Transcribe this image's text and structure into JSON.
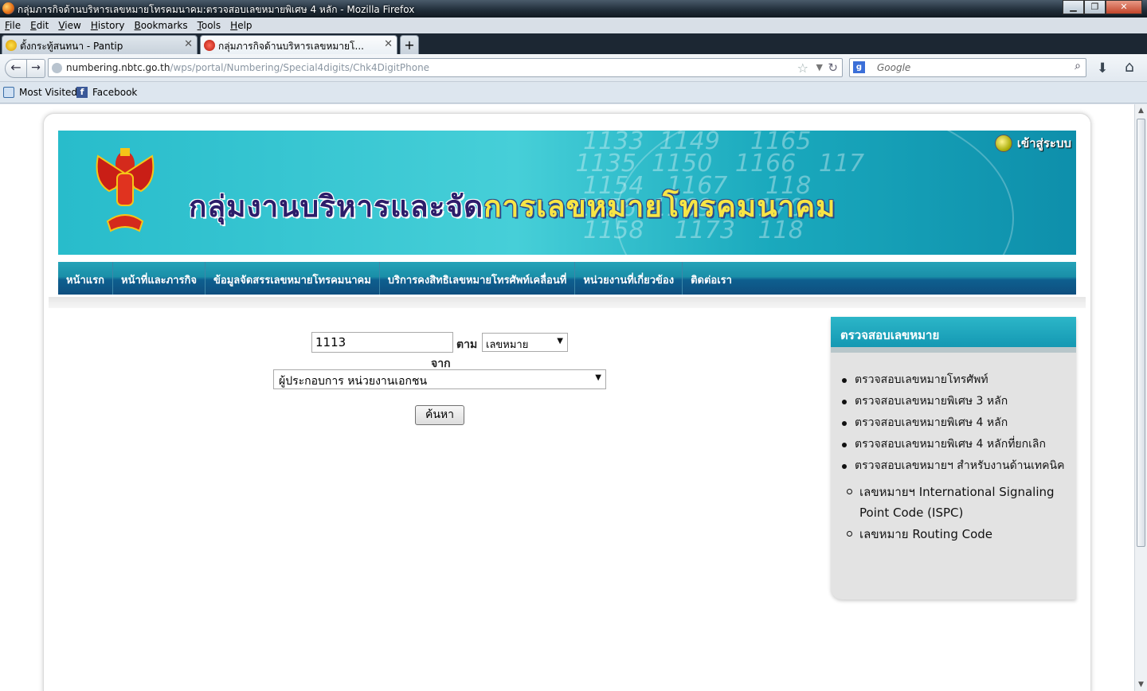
{
  "window": {
    "title": "กลุ่มภารกิจด้านบริหารเลขหมายโทรคมนาคม:ตรวจสอบเลขหมายพิเศษ 4 หลัก - Mozilla Firefox",
    "minimize": "▁",
    "maximize": "❐",
    "close": "✕"
  },
  "menu": [
    "File",
    "Edit",
    "View",
    "History",
    "Bookmarks",
    "Tools",
    "Help"
  ],
  "tabs": [
    {
      "label": "ตั้งกระทู้สนทนา - Pantip",
      "close": "✕"
    },
    {
      "label": "กลุ่มภารกิจด้านบริหารเลขหมายโ...",
      "close": "✕"
    }
  ],
  "new_tab": "+",
  "nav": {
    "back": "←",
    "forward": "→",
    "url_host": "numbering.nbtc.go.th",
    "url_path": "/wps/portal/Numbering/Special4digits/Chk4DigitPhone",
    "star": "☆",
    "dropdown": "▼",
    "reload": "↻",
    "search_placeholder": "Google",
    "search_engine_letter": "g",
    "search_btn": "⌕",
    "download": "⬇",
    "home": "⌂"
  },
  "bookmarks": [
    {
      "label": "Most Visited",
      "icon": "most-visited-icon"
    },
    {
      "label": "Facebook",
      "icon": "facebook-icon"
    }
  ],
  "banner": {
    "title_part1": "กลุ่มงานบริหารและจัด",
    "title_part2": "การเลขหมายโทรคมนาคม",
    "login": "เข้าสู่ระบบ"
  },
  "main_nav": [
    "หน้าแรก",
    "หน้าที่และภารกิจ",
    "ข้อมูลจัดสรรเลขหมายโทรคมนาคม",
    "บริการคงสิทธิเลขหมายโทรศัพท์เคลื่อนที่",
    "หน่วยงานที่เกี่ยวข้อง",
    "ติดต่อเรา"
  ],
  "search_form": {
    "number_value": "1113",
    "by_label": "ตาม",
    "by_selected": "เลขหมาย",
    "from_label": "จาก",
    "from_selected": "ผู้ประกอบการ หน่วยงานเอกชน",
    "submit": "ค้นหา"
  },
  "sidebox": {
    "title": "ตรวจสอบเลขหมาย",
    "items": [
      "ตรวจสอบเลขหมายโทรศัพท์",
      "ตรวจสอบเลขหมายพิเศษ 3 หลัก",
      "ตรวจสอบเลขหมายพิเศษ 4 หลัก",
      "ตรวจสอบเลขหมายพิเศษ 4 หลักที่ยกเลิก",
      "ตรวจสอบเลขหมายฯ สำหรับงานด้านเทคนิค"
    ],
    "subitems": [
      "เลขหมายฯ International Signaling Point Code (ISPC)",
      "เลขหมาย Routing Code"
    ]
  },
  "scrollbar": {
    "up": "▲",
    "down": "▼"
  },
  "colors": {
    "banner": "#2bbdcc",
    "nav": "#1a7fa3",
    "sidebox_header": "#1fa8bd"
  }
}
